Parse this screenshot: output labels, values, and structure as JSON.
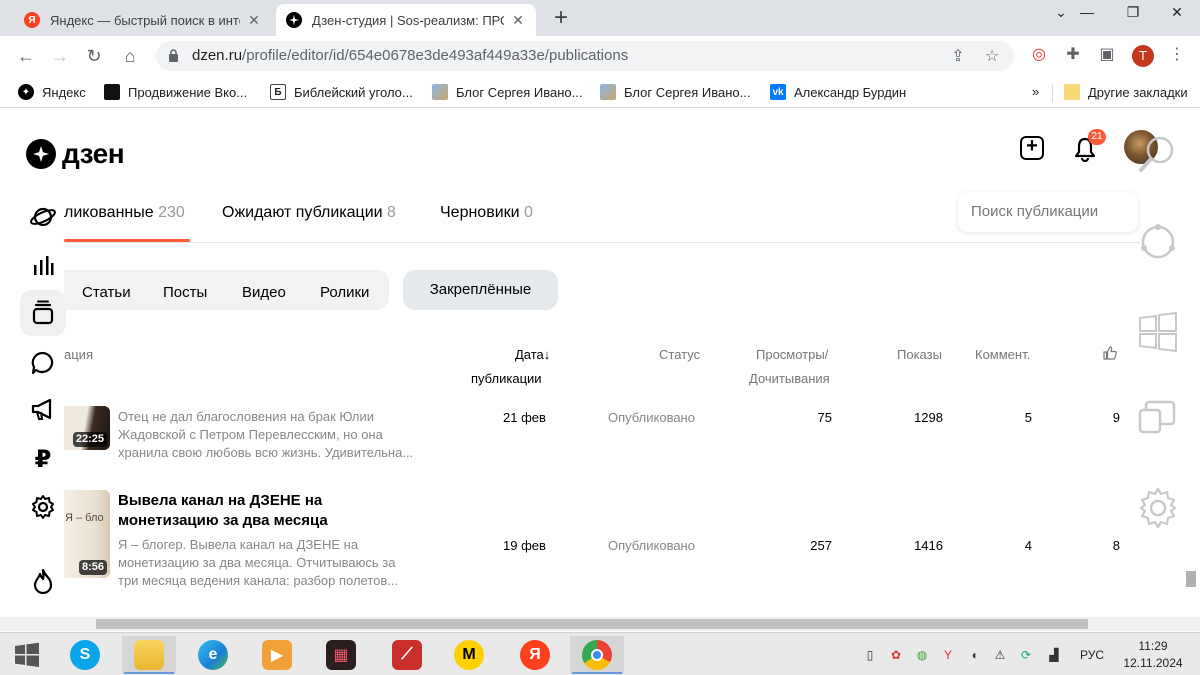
{
  "browser": {
    "tabs": [
      {
        "title": "Яндекс — быстрый поиск в интернете",
        "favicon": "yandex-icon",
        "favicon_color": "#fc3f1d"
      },
      {
        "title": "Дзен-студия | Sos-реализм: ПРО",
        "favicon": "dzen-icon",
        "favicon_color": "#000000"
      }
    ],
    "address": {
      "host": "dzen.ru",
      "path": "/profile/editor/id/654e0678e3de493af449a33e/publications"
    },
    "profile_letter": "Т",
    "bookmarks": [
      {
        "label": "Яндекс",
        "icon": "dzen-icon"
      },
      {
        "label": "Продвижение Вко...",
        "icon": "black-square-icon"
      },
      {
        "label": "Библейский уголо...",
        "icon": "book-icon"
      },
      {
        "label": "Блог Сергея Ивано...",
        "icon": "image-icon"
      },
      {
        "label": "Блог Сергея Ивано...",
        "icon": "image-icon"
      },
      {
        "label": "Александр Бурдин",
        "icon": "vk-icon"
      }
    ],
    "other_bookmarks": "Другие закладки",
    "more_chevron": "»"
  },
  "dzen": {
    "logo": "дзен",
    "notifications_count": "21",
    "tabs": [
      {
        "label": "ликованные",
        "count": "230"
      },
      {
        "label": "Ожидают публикации",
        "count": "8"
      },
      {
        "label": "Черновики",
        "count": "0"
      }
    ],
    "search_placeholder": "Поиск публикации",
    "filters": [
      "Статьи",
      "Посты",
      "Видео",
      "Ролики",
      "Закреплённые"
    ],
    "columns": {
      "publication": "ация",
      "date_line1": "Дата",
      "date_arrow": "↓",
      "date_line2": "публикации",
      "status": "Статус",
      "views_line1": "Просмотры/",
      "views_line2": "Дочитывания",
      "impressions": "Показы",
      "comments": "Коммент."
    },
    "rows": [
      {
        "title": "",
        "description": "Отец не дал благословения на брак Юлии Жадовской с Петром Перевлесским, но она хранила свою любовь всю жизнь. Удивительна...",
        "duration": "22:25",
        "date": "21 фев",
        "status": "Опубликовано",
        "views": "75",
        "impressions": "1298",
        "comments": "5",
        "likes": "9"
      },
      {
        "title": "Вывела канал на ДЗЕНЕ на монетизацию за два месяца",
        "description": "Я – блогер. Вывела канал на ДЗЕНЕ на монетизацию за два месяца. Отчитываюсь за три месяца ведения канала: разбор полетов...",
        "duration": "8:56",
        "thumb_caption": "Я – бло",
        "date": "19 фев",
        "status": "Опубликовано",
        "views": "257",
        "impressions": "1416",
        "comments": "4",
        "likes": "8"
      }
    ],
    "accent_color": "#ff5b3a"
  },
  "taskbar": {
    "language": "РУС",
    "time": "11:29",
    "date": "12.11.2024"
  }
}
